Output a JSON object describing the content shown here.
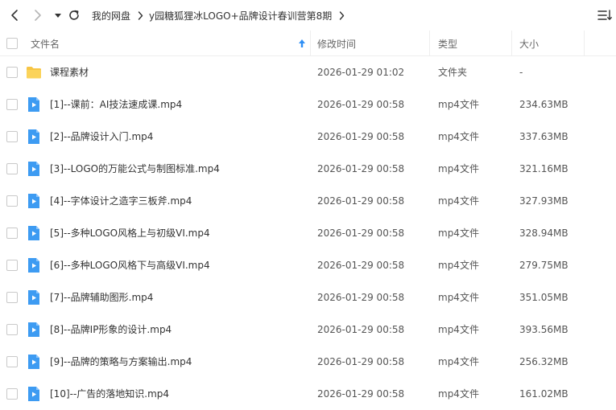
{
  "toolbar": {
    "breadcrumb": [
      "我的网盘",
      "y园糖狐狸冰LOGO+品牌设计春训营第8期"
    ]
  },
  "header": {
    "name": "文件名",
    "modified": "修改时间",
    "type": "类型",
    "size": "大小"
  },
  "colors": {
    "folder": "#f7c545",
    "video_icon": "#3d9bf2",
    "accent": "#2f8ff5"
  },
  "rows": [
    {
      "name": "课程素材",
      "date": "2026-01-29 01:02",
      "type": "文件夹",
      "size": "-",
      "icon": "folder-icon"
    },
    {
      "name": "[1]--课前：AI技法速成课.mp4",
      "date": "2026-01-29 00:58",
      "type": "mp4文件",
      "size": "234.63MB",
      "icon": "video-file-icon"
    },
    {
      "name": "[2]--品牌设计入门.mp4",
      "date": "2026-01-29 00:58",
      "type": "mp4文件",
      "size": "337.63MB",
      "icon": "video-file-icon"
    },
    {
      "name": "[3]--LOGO的万能公式与制图标准.mp4",
      "date": "2026-01-29 00:58",
      "type": "mp4文件",
      "size": "321.16MB",
      "icon": "video-file-icon"
    },
    {
      "name": "[4]--字体设计之造字三板斧.mp4",
      "date": "2026-01-29 00:58",
      "type": "mp4文件",
      "size": "327.93MB",
      "icon": "video-file-icon"
    },
    {
      "name": "[5]--多种LOGO风格上与初级VI.mp4",
      "date": "2026-01-29 00:58",
      "type": "mp4文件",
      "size": "328.94MB",
      "icon": "video-file-icon"
    },
    {
      "name": "[6]--多种LOGO风格下与高级VI.mp4",
      "date": "2026-01-29 00:58",
      "type": "mp4文件",
      "size": "279.75MB",
      "icon": "video-file-icon"
    },
    {
      "name": "[7]--品牌辅助图形.mp4",
      "date": "2026-01-29 00:58",
      "type": "mp4文件",
      "size": "351.05MB",
      "icon": "video-file-icon"
    },
    {
      "name": "[8]--品牌IP形象的设计.mp4",
      "date": "2026-01-29 00:58",
      "type": "mp4文件",
      "size": "393.56MB",
      "icon": "video-file-icon"
    },
    {
      "name": "[9]--品牌的策略与方案输出.mp4",
      "date": "2026-01-29 00:58",
      "type": "mp4文件",
      "size": "256.32MB",
      "icon": "video-file-icon"
    },
    {
      "name": "[10]--广告的落地知识.mp4",
      "date": "2026-01-29 00:58",
      "type": "mp4文件",
      "size": "161.02MB",
      "icon": "video-file-icon"
    }
  ]
}
